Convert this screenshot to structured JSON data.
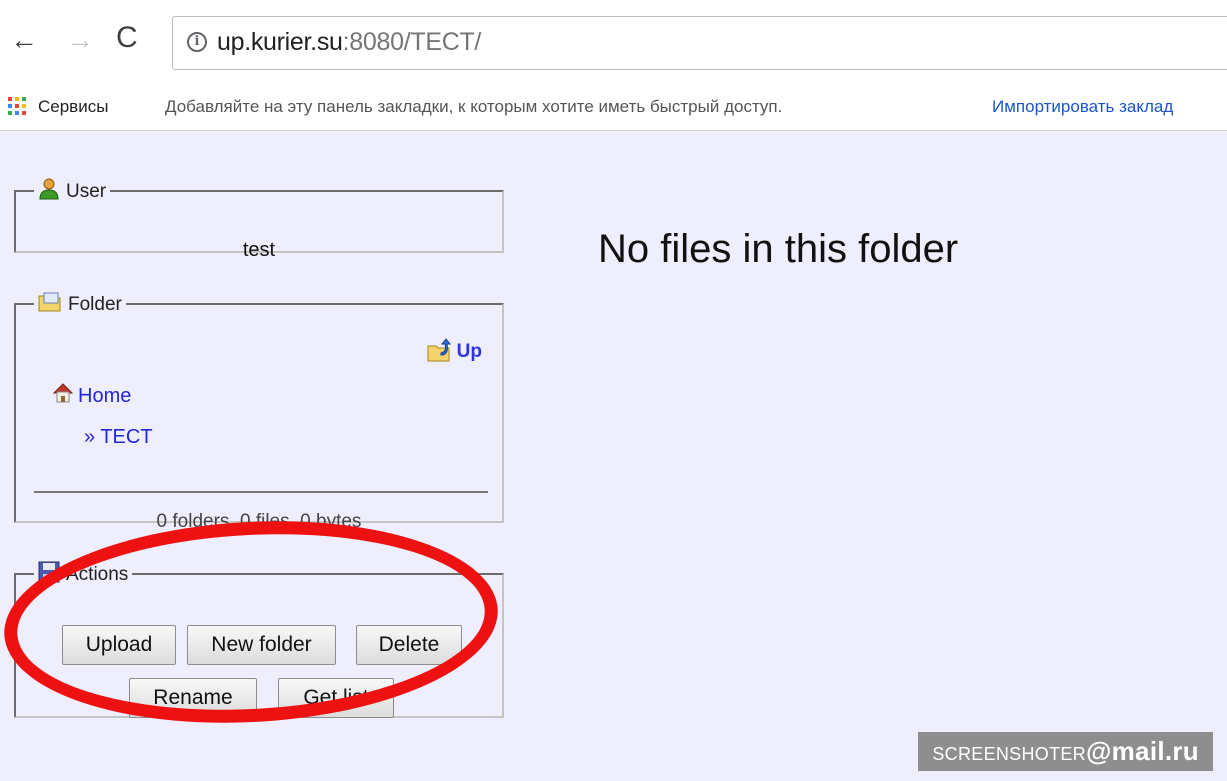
{
  "browser": {
    "url_host": "up.kurier.su",
    "url_rest": ":8080/TECT/",
    "back_symbol": "←",
    "forward_symbol": "→",
    "reload_symbol": "C",
    "info_symbol": "i"
  },
  "bookmarks_bar": {
    "services_label": "Сервисы",
    "hint_text": "Добавляйте на эту панель закладки, к которым хотите иметь быстрый доступ.",
    "import_link": "Импортировать заклад"
  },
  "user_panel": {
    "legend": "User",
    "icon": "user-icon",
    "username": "test"
  },
  "folder_panel": {
    "legend": "Folder",
    "icon": "folder-icon",
    "up_label": "Up",
    "up_icon": "folder-up-icon",
    "home_label": "Home",
    "home_icon": "home-icon",
    "current_folder": "» TECT",
    "stats": "0 folders, 0 files, 0 bytes"
  },
  "actions_panel": {
    "legend": "Actions",
    "icon": "floppy-disk-icon",
    "buttons": {
      "upload": "Upload",
      "new_folder": "New folder",
      "delete": "Delete",
      "rename": "Rename",
      "get_list": "Get list"
    }
  },
  "main": {
    "empty_message": "No files in this folder"
  },
  "watermark": {
    "prefix": "SCREENSHOTER",
    "suffix": "@mail.ru"
  },
  "colors": {
    "page_background": "#eeeefc",
    "link": "#2424d8",
    "annotation_red": "#ee1111"
  }
}
